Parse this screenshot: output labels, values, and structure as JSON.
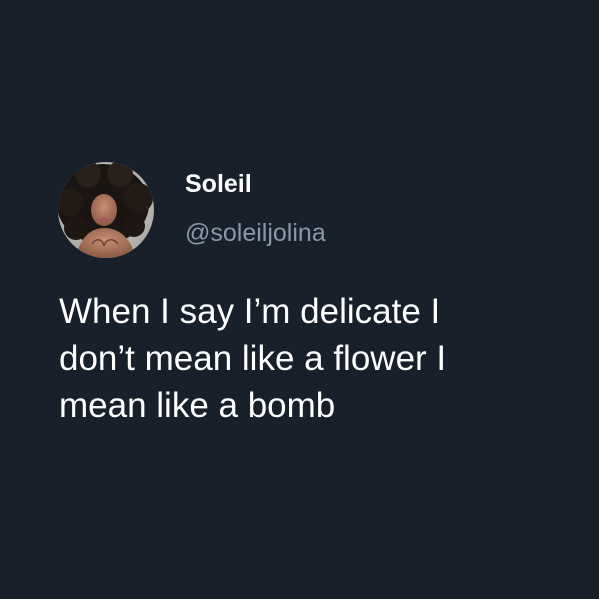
{
  "theme": {
    "background": "#17202b",
    "name_color": "#ffffff",
    "handle_color": "#8b98a5",
    "text_color": "#ffffff"
  },
  "user": {
    "display_name": "Soleil",
    "handle": "@soleiljolina",
    "avatar_icon": "profile-photo"
  },
  "tweet": {
    "lines": [
      "When I say I’m delicate I",
      "don’t mean like a flower I",
      "mean like a bomb"
    ]
  }
}
